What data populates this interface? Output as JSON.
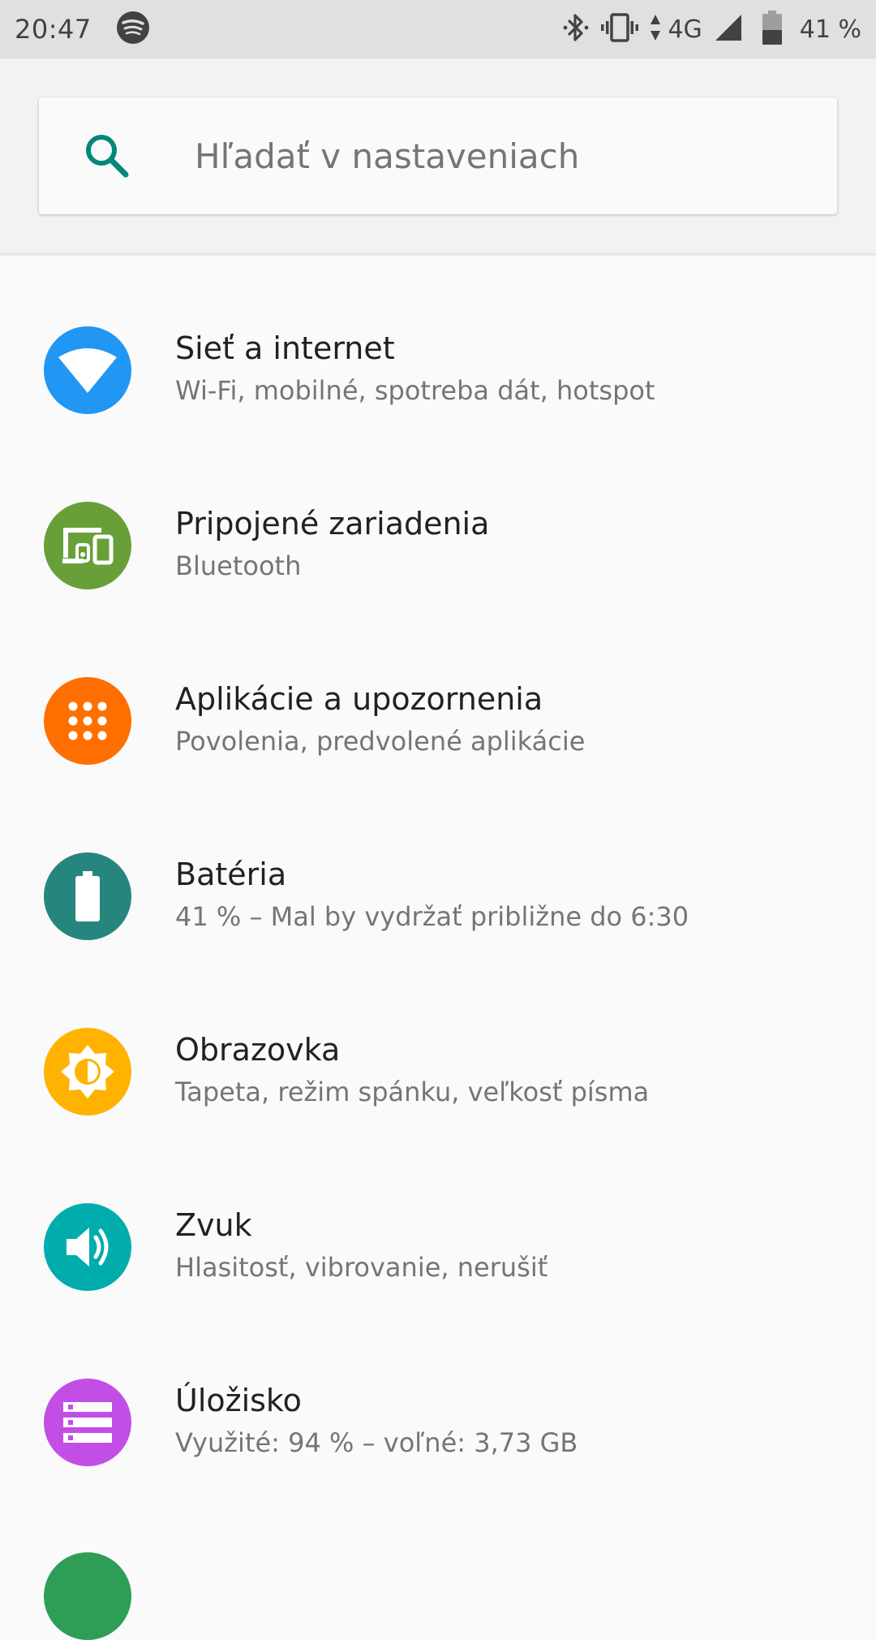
{
  "status_bar": {
    "time": "20:47",
    "network": "4G",
    "battery": "41 %",
    "icons": [
      "spotify-icon",
      "bluetooth-icon",
      "vibrate-icon",
      "data-arrows-icon",
      "signal-icon",
      "battery-icon"
    ]
  },
  "search": {
    "placeholder": "Hľadať v nastaveniach",
    "icon": "search-icon",
    "accent": "#00897b"
  },
  "settings": [
    {
      "title": "Sieť a internet",
      "subtitle": "Wi-Fi, mobilné, spotreba dát, hotspot",
      "icon": "wifi-icon",
      "color": "#2196f3"
    },
    {
      "title": "Pripojené zariadenia",
      "subtitle": "Bluetooth",
      "icon": "devices-icon",
      "color": "#689f38"
    },
    {
      "title": "Aplikácie a upozornenia",
      "subtitle": "Povolenia, predvolené aplikácie",
      "icon": "apps-icon",
      "color": "#ff6f00"
    },
    {
      "title": "Batéria",
      "subtitle": "41 % – Mal by vydržať približne do 6:30",
      "icon": "battery-icon",
      "color": "#26867d"
    },
    {
      "title": "Obrazovka",
      "subtitle": "Tapeta, režim spánku, veľkosť písma",
      "icon": "brightness-icon",
      "color": "#ffb300"
    },
    {
      "title": "Zvuk",
      "subtitle": "Hlasitosť, vibrovanie, nerušiť",
      "icon": "volume-icon",
      "color": "#00acac"
    },
    {
      "title": "Úložisko",
      "subtitle": "Využité: 94 % – voľné: 3,73 GB",
      "icon": "storage-icon",
      "color": "#c34ee6"
    }
  ]
}
